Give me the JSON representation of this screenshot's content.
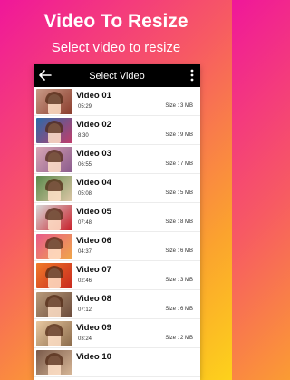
{
  "promo": {
    "title": "Video To Resize",
    "subtitle": "Select video to resize"
  },
  "appbar": {
    "title": "Select Video",
    "back_icon": "back-arrow-icon",
    "menu_icon": "more-vert-icon"
  },
  "videos": [
    {
      "name": "Video 01",
      "duration": "05:29",
      "size": "Size : 3 MB",
      "thumb_colors": [
        "#c89a86",
        "#8a3c2c"
      ]
    },
    {
      "name": "Video 02",
      "duration": "8:30",
      "size": "Size : 9 MB",
      "thumb_colors": [
        "#2c6aa8",
        "#c23c6a"
      ]
    },
    {
      "name": "Video 03",
      "duration": "06:55",
      "size": "Size : 7 MB",
      "thumb_colors": [
        "#d8a6b4",
        "#8a5a8c"
      ]
    },
    {
      "name": "Video 04",
      "duration": "05:08",
      "size": "Size : 5 MB",
      "thumb_colors": [
        "#5a8a4c",
        "#e0c8a8"
      ]
    },
    {
      "name": "Video 05",
      "duration": "07:48",
      "size": "Size : 8 MB",
      "thumb_colors": [
        "#d8d8d8",
        "#c81e28"
      ]
    },
    {
      "name": "Video 06",
      "duration": "04:37",
      "size": "Size : 6 MB",
      "thumb_colors": [
        "#e85a8a",
        "#f0a848"
      ]
    },
    {
      "name": "Video 07",
      "duration": "02:46",
      "size": "Size : 3 MB",
      "thumb_colors": [
        "#f07a2a",
        "#c8281e"
      ]
    },
    {
      "name": "Video 08",
      "duration": "07:12",
      "size": "Size : 6 MB",
      "thumb_colors": [
        "#b89a7a",
        "#6a4a3a"
      ]
    },
    {
      "name": "Video 09",
      "duration": "03:24",
      "size": "Size : 2 MB",
      "thumb_colors": [
        "#e8c8a0",
        "#8a6a4a"
      ]
    },
    {
      "name": "Video 10",
      "duration": "",
      "size": "",
      "thumb_colors": [
        "#7a5a4a",
        "#d8b898"
      ]
    }
  ]
}
